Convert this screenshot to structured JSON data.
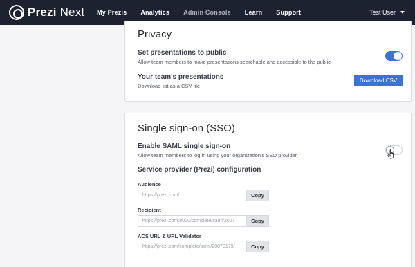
{
  "header": {
    "logo_bold": "Prezi",
    "logo_light": " Next",
    "nav": [
      "My Prezis",
      "Analytics",
      "Admin Console",
      "Learn",
      "Support"
    ],
    "user_name": "Test User"
  },
  "privacy": {
    "title": "Privacy",
    "public_title": "Set presentations to public",
    "public_desc": "Allow team members to make presentations searchable and accessible to the public",
    "public_toggle": "on",
    "list_title": "Your team's presentations",
    "list_desc": "Download list as a CSV file",
    "download_label": "Download CSV"
  },
  "sso": {
    "title": "Single sign-on (SSO)",
    "enable_title": "Enable SAML single sign-on",
    "enable_desc": "Allow team members to log in using your organization's SSO provider",
    "enable_toggle": "off",
    "config_title": "Service provider (Prezi) configuration",
    "fields": [
      {
        "label": "Audience",
        "value": "https://prezi.com/",
        "copy": "Copy"
      },
      {
        "label": "Recipient",
        "value": "https://prezi.com:8000/complete/saml/2007",
        "copy": "Copy"
      },
      {
        "label": "ACS URL & URL Validator",
        "value": "https://prezi.com/complete/saml/20070179/",
        "copy": "Copy"
      }
    ]
  },
  "colors": {
    "nav_bg": "#1c2230",
    "accent": "#3a72d8",
    "page_bg": "#f5f5f7"
  }
}
